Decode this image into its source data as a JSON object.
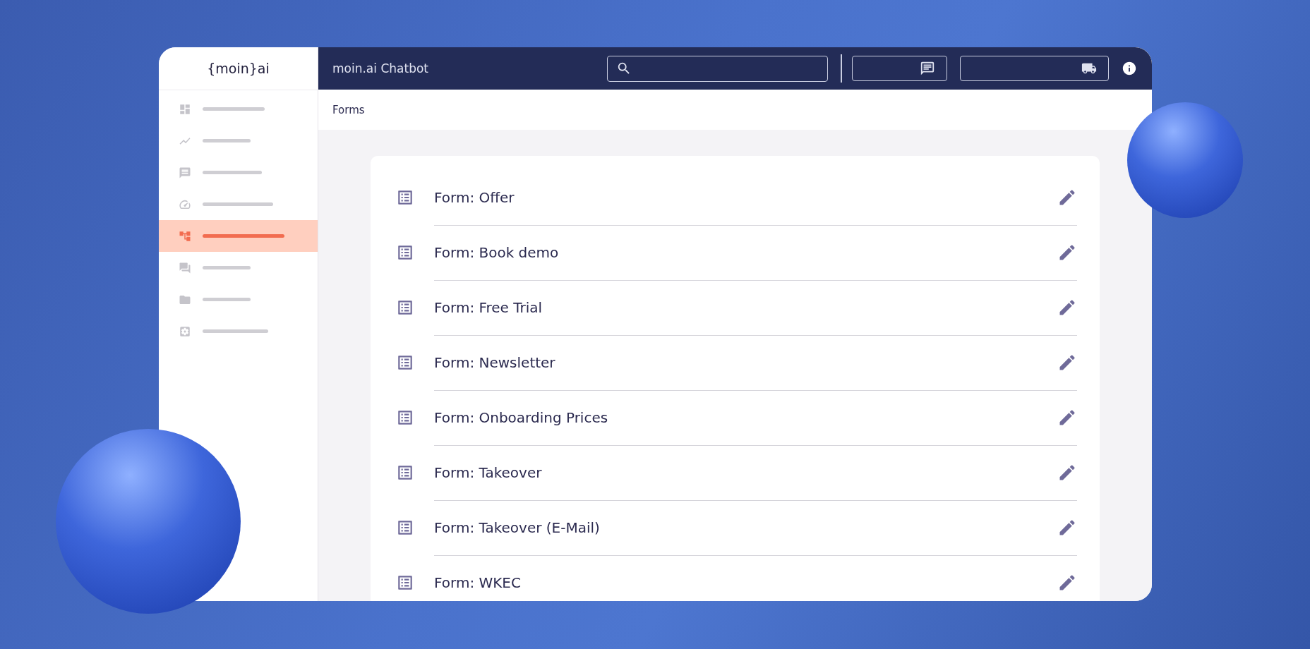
{
  "sidebar": {
    "logo": "{moin}ai",
    "items": [
      {
        "selected": false
      },
      {
        "selected": false
      },
      {
        "selected": false
      },
      {
        "selected": false
      },
      {
        "selected": true
      },
      {
        "selected": false
      },
      {
        "selected": false
      },
      {
        "selected": false
      }
    ]
  },
  "topbar": {
    "title": "moin.ai Chatbot"
  },
  "breadcrumb": "Forms",
  "forms": [
    {
      "title": "Form: Offer"
    },
    {
      "title": "Form: Book demo"
    },
    {
      "title": "Form: Free Trial"
    },
    {
      "title": "Form: Newsletter"
    },
    {
      "title": "Form: Onboarding Prices"
    },
    {
      "title": "Form: Takeover"
    },
    {
      "title": "Form: Takeover (E-Mail)"
    },
    {
      "title": "Form: WKEC"
    }
  ]
}
